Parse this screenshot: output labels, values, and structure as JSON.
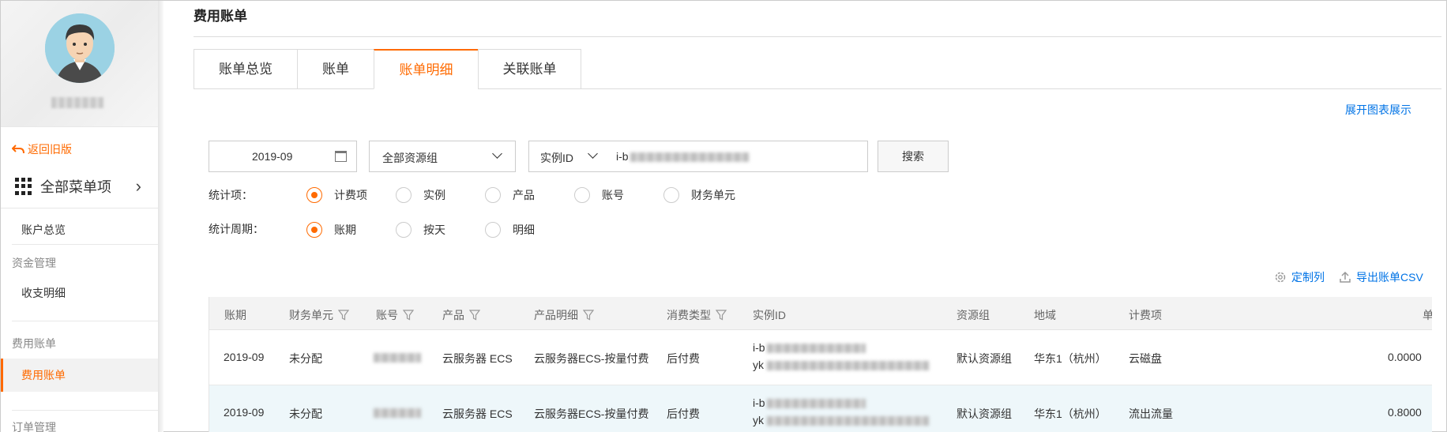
{
  "sidebar": {
    "back_label": "返回旧版",
    "all_menu_label": "全部菜单项",
    "items": [
      {
        "type": "item",
        "label": "账户总览"
      },
      {
        "type": "group",
        "label": "资金管理"
      },
      {
        "type": "item",
        "label": "收支明细"
      },
      {
        "type": "group",
        "label": "费用账单"
      },
      {
        "type": "item",
        "label": "费用账单",
        "active": true
      },
      {
        "type": "group",
        "label": "订单管理"
      }
    ]
  },
  "page": {
    "title": "费用账单",
    "tabs": [
      {
        "label": "账单总览",
        "active": false
      },
      {
        "label": "账单",
        "active": false
      },
      {
        "label": "账单明细",
        "active": true
      },
      {
        "label": "关联账单",
        "active": false
      }
    ],
    "chart_toggle_link": "展开图表展示"
  },
  "filters": {
    "date_value": "2019-09",
    "resource_group_value": "全部资源组",
    "instance_field_label": "实例ID",
    "instance_value_prefix": "i-b",
    "search_button": "搜索",
    "stat_items_label": "统计项：",
    "stat_items": [
      {
        "label": "计费项",
        "checked": true
      },
      {
        "label": "实例",
        "checked": false
      },
      {
        "label": "产品",
        "checked": false
      },
      {
        "label": "账号",
        "checked": false
      },
      {
        "label": "财务单元",
        "checked": false
      }
    ],
    "stat_period_label": "统计周期：",
    "stat_periods": [
      {
        "label": "账期",
        "checked": true
      },
      {
        "label": "按天",
        "checked": false
      },
      {
        "label": "明细",
        "checked": false
      }
    ]
  },
  "toolbar": {
    "customize_columns": "定制列",
    "export_csv": "导出账单CSV"
  },
  "table": {
    "columns": [
      "账期",
      "财务单元",
      "账号",
      "产品",
      "产品明细",
      "消费类型",
      "实例ID",
      "资源组",
      "地域",
      "计费项",
      "单"
    ],
    "rows": [
      {
        "period": "2019-09",
        "finance_unit": "未分配",
        "product": "云服务器 ECS",
        "product_detail": "云服务器ECS-按量付费",
        "consume_type": "后付费",
        "instance_prefix_1": "i-b",
        "instance_prefix_2": "yk",
        "resource_group": "默认资源组",
        "region": "华东1（杭州）",
        "billing_item": "云磁盘",
        "price": "0.0000"
      },
      {
        "period": "2019-09",
        "finance_unit": "未分配",
        "product": "云服务器 ECS",
        "product_detail": "云服务器ECS-按量付费",
        "consume_type": "后付费",
        "instance_prefix_1": "i-b",
        "instance_prefix_2": "yk",
        "resource_group": "默认资源组",
        "region": "华东1（杭州）",
        "billing_item": "流出流量",
        "price": "0.8000"
      }
    ]
  },
  "colors": {
    "accent": "#ff6a00",
    "link": "#0073e6"
  }
}
